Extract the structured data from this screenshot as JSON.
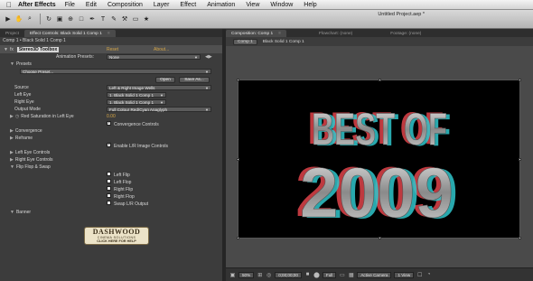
{
  "menubar": {
    "app": "After Effects",
    "items": [
      "File",
      "Edit",
      "Composition",
      "Layer",
      "Effect",
      "Animation",
      "View",
      "Window",
      "Help"
    ]
  },
  "toolbar": {
    "doc_title": "Untitled Project.aep *"
  },
  "left_tabs": [
    {
      "label": "Project"
    },
    {
      "label": "Effect Controls: Black Solid 1 Comp 1"
    }
  ],
  "right_tabs": [
    {
      "label": "Composition: Comp 1"
    },
    {
      "label": "Flowchart: (none)"
    },
    {
      "label": "Footage: (none)"
    }
  ],
  "effect_controls": {
    "breadcrumb": "Comp 1 • Black Solid 1 Comp 1",
    "fx_name": "Stereo3D Toolbox",
    "reset": "Reset",
    "about": "About...",
    "animation_presets_label": "Animation Presets:",
    "animation_presets_value": "None",
    "presets_label": "Presets",
    "choose_preset": "Choose Preset...",
    "open_button": "Open",
    "save_as_button": "Save As...",
    "source_label": "Source",
    "source_value": "Left & Right Image Wells",
    "left_eye_label": "Left Eye",
    "left_eye_value": "1. Black Solid 1 Comp 1",
    "right_eye_label": "Right Eye",
    "right_eye_value": "1. Black Solid 1 Comp 1",
    "output_mode_label": "Output Mode",
    "output_mode_value": "Full Colour Red/Cyan Anaglyph",
    "red_saturation_label": "Red Saturation in Left Eye",
    "red_saturation_value": "0.00",
    "convergence_controls_label": "Convergence Controls",
    "convergence_label": "Convergence",
    "reframe_label": "Reframe",
    "enable_lr_label": "Enable L/R Image Controls",
    "left_eye_controls_label": "Left Eye Controls",
    "right_eye_controls_label": "Right Eye Controls",
    "flip_flop_label": "Flip Flop & Swap",
    "flips": [
      "Left Flip",
      "Left Flop",
      "Right Flip",
      "Right Flop",
      "Swap L/R Output"
    ],
    "banner_label": "Banner",
    "logo_name": "DASHWOOD",
    "logo_sub": "CINEMA SOLUTIONS",
    "logo_help": "CLICK HERE FOR HELP"
  },
  "composition": {
    "comp_button": "Comp 1",
    "layer_name": "Black Solid 1 Comp 1",
    "title_line1": "BEST OF",
    "title_line2": "2009"
  },
  "viewer_bar": {
    "zoom": "50%",
    "timecode": "0;00;00;00",
    "resolution": "Full",
    "camera": "Active Camera",
    "view": "1 View"
  },
  "colors": {
    "anaglyph_red": "#e0434a",
    "anaglyph_cyan": "#30c6cc",
    "accent_orange": "#d6a647"
  }
}
